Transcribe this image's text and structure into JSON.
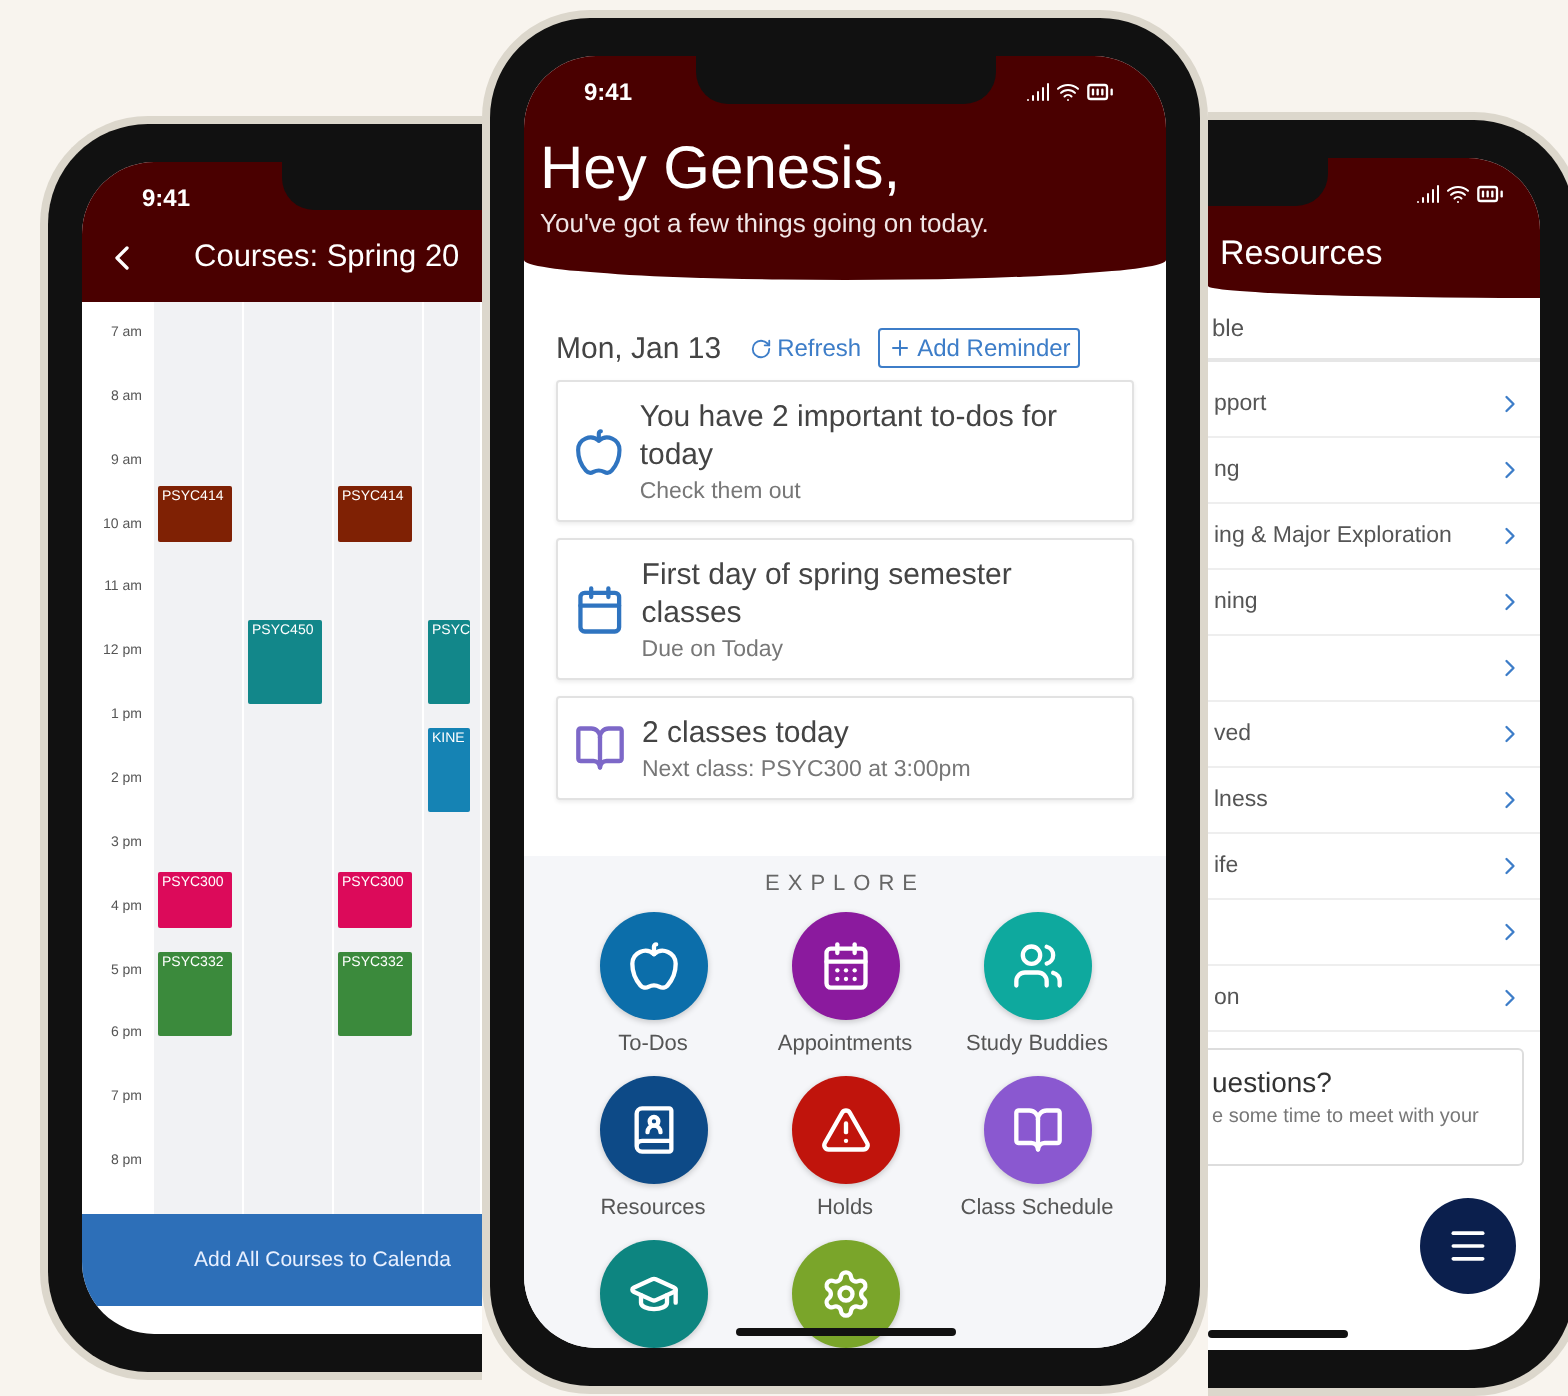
{
  "calendar_screen": {
    "status_time": "9:41",
    "title": "Courses: Spring 20",
    "time_labels": [
      "7 am",
      "8 am",
      "9 am",
      "10 am",
      "11 am",
      "12 pm",
      "1 pm",
      "2 pm",
      "3 pm",
      "4 pm",
      "5 pm",
      "6 pm",
      "7 pm",
      "8 pm"
    ],
    "day_columns": [
      {
        "events": [
          {
            "label": "PSYC414",
            "color": "#7f2104"
          },
          {
            "label": "PSYC300",
            "color": "#dc0a5a"
          },
          {
            "label": "PSYC332",
            "color": "#3b8a3c"
          }
        ]
      },
      {
        "events": [
          {
            "label": "PSYC450",
            "color": "#12878a"
          }
        ]
      },
      {
        "events": [
          {
            "label": "PSYC414",
            "color": "#7f2104"
          },
          {
            "label": "PSYC300",
            "color": "#dc0a5a"
          },
          {
            "label": "PSYC332",
            "color": "#3b8a3c"
          }
        ]
      },
      {
        "events": [
          {
            "label": "PSYC",
            "color": "#12878a"
          },
          {
            "label": "KINE",
            "color": "#1583b4"
          }
        ]
      }
    ],
    "footer_button": "Add All Courses to Calenda"
  },
  "home_screen": {
    "status_time": "9:41",
    "greeting": "Hey Genesis,",
    "subtitle": "You've got a few things going on today.",
    "date": "Mon, Jan 13",
    "refresh": "Refresh",
    "add_reminder": "Add Reminder",
    "cards": [
      {
        "kind": "todo",
        "title": "You have 2 important to-dos for today",
        "subtitle": "Check them out"
      },
      {
        "kind": "calendar",
        "title": "First day of spring semester classes",
        "subtitle": "Due on Today"
      },
      {
        "kind": "classes",
        "title": "2 classes today",
        "subtitle": "Next class: PSYC300 at 3:00pm"
      }
    ],
    "explore_title": "EXPLORE",
    "explore": [
      {
        "kind": "todo",
        "label": "To-Dos",
        "color": "#0c6eaa"
      },
      {
        "kind": "appointments",
        "label": "Appointments",
        "color": "#8b1a9e"
      },
      {
        "kind": "buddies",
        "label": "Study Buddies",
        "color": "#0ea99e"
      },
      {
        "kind": "resources",
        "label": "Resources",
        "color": "#0d4a87"
      },
      {
        "kind": "holds",
        "label": "Holds",
        "color": "#c0140c"
      },
      {
        "kind": "schedule",
        "label": "Class Schedule",
        "color": "#8a58d0"
      },
      {
        "kind": "graduation",
        "color": "#0d8580"
      },
      {
        "kind": "settings",
        "color": "#7aa52a"
      }
    ]
  },
  "resources_screen": {
    "title": "Resources",
    "search_text": "ble",
    "rows": [
      {
        "label": "pport"
      },
      {
        "label": "ng"
      },
      {
        "label": "ing & Major Exploration"
      },
      {
        "label": "ning"
      },
      {},
      {
        "label": "ved"
      },
      {
        "label": "lness"
      },
      {
        "label": "ife"
      },
      {},
      {
        "label": "on"
      }
    ],
    "card": {
      "title": "uestions?",
      "text": "e some time to meet with your"
    }
  }
}
